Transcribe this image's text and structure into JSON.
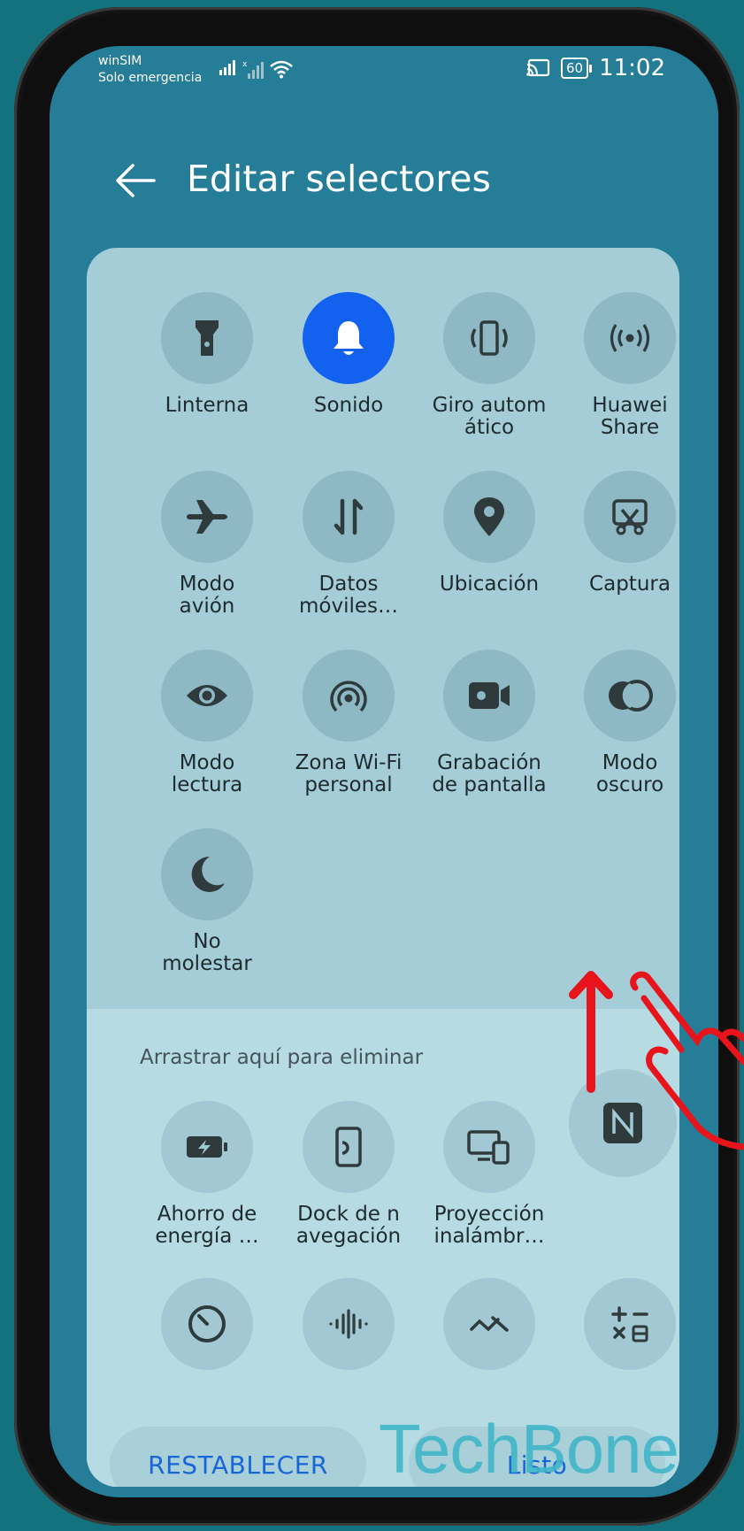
{
  "status_bar": {
    "carrier": "winSIM",
    "carrier_status": "Solo emergencia",
    "battery_level": "60",
    "time": "11:02"
  },
  "header": {
    "title": "Editar selectores"
  },
  "active_tiles": [
    {
      "label": "Linterna",
      "icon": "flashlight-icon"
    },
    {
      "label": "Sonido",
      "icon": "bell-icon",
      "active": true
    },
    {
      "label": "Giro autom\nático",
      "icon": "auto-rotate-icon"
    },
    {
      "label": "Huawei\nShare",
      "icon": "huawei-share-icon"
    },
    {
      "label": "Modo\navión",
      "icon": "airplane-icon"
    },
    {
      "label": "Datos\nmóviles…",
      "icon": "mobile-data-icon"
    },
    {
      "label": "Ubicación",
      "icon": "location-icon"
    },
    {
      "label": "Captura",
      "icon": "screenshot-icon"
    },
    {
      "label": "Modo\nlectura",
      "icon": "eye-icon"
    },
    {
      "label": "Zona Wi-Fi\npersonal",
      "icon": "hotspot-icon"
    },
    {
      "label": "Grabación\nde pantalla",
      "icon": "video-icon"
    },
    {
      "label": "Modo\noscuro",
      "icon": "dark-mode-icon"
    },
    {
      "label": "No\nmolestar",
      "icon": "moon-icon"
    }
  ],
  "remove_zone": {
    "title": "Arrastrar aquí para eliminar",
    "tiles": [
      {
        "label": "Ahorro de\nenergía …",
        "icon": "battery-saver-icon"
      },
      {
        "label": "Dock de n\navegación",
        "icon": "nav-dock-icon"
      },
      {
        "label": "Proyección\ninalámbr…",
        "icon": "wireless-projection-icon"
      },
      {
        "label": "",
        "icon": "nfc-icon"
      },
      {
        "label": "",
        "icon": "timer-icon"
      },
      {
        "label": "",
        "icon": "sound-wave-icon"
      },
      {
        "label": "",
        "icon": "link-icon"
      },
      {
        "label": "",
        "icon": "calculator-icon"
      }
    ]
  },
  "buttons": {
    "reset": "RESTABLECER",
    "done": "Listo"
  },
  "watermark": "TechBone",
  "colors": {
    "active_blue": "#1262ef",
    "button_text": "#1766d8",
    "gesture_red": "#e8141b"
  }
}
